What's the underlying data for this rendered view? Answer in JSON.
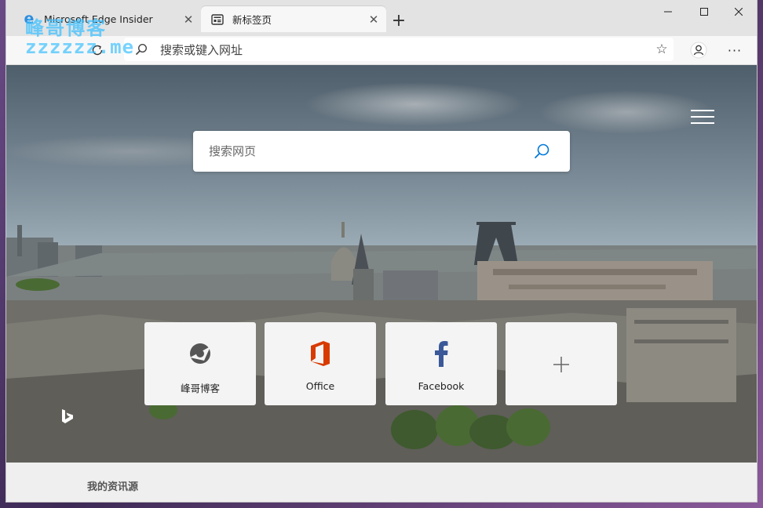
{
  "tabs": [
    {
      "title": "Microsoft Edge Insider",
      "icon": "edge-logo-icon",
      "active": false
    },
    {
      "title": "新标签页",
      "icon": "newtab-page-icon",
      "active": true
    }
  ],
  "watermark": {
    "line1": "峰哥博客",
    "line2": "zzzzzz.me"
  },
  "address_bar": {
    "placeholder": "搜索或键入网址"
  },
  "search": {
    "placeholder": "搜索网页"
  },
  "quick_links": [
    {
      "label": "峰哥博客",
      "icon": "fengge-logo-icon"
    },
    {
      "label": "Office",
      "icon": "office-logo-icon"
    },
    {
      "label": "Facebook",
      "icon": "facebook-logo-icon"
    },
    {
      "label": "",
      "icon": "plus-icon"
    }
  ],
  "feed": {
    "label": "我的资讯源"
  },
  "colors": {
    "accent": "#0078d7",
    "office": "#d83b01",
    "facebook": "#3b5998",
    "edge": "#2f8ee0"
  }
}
